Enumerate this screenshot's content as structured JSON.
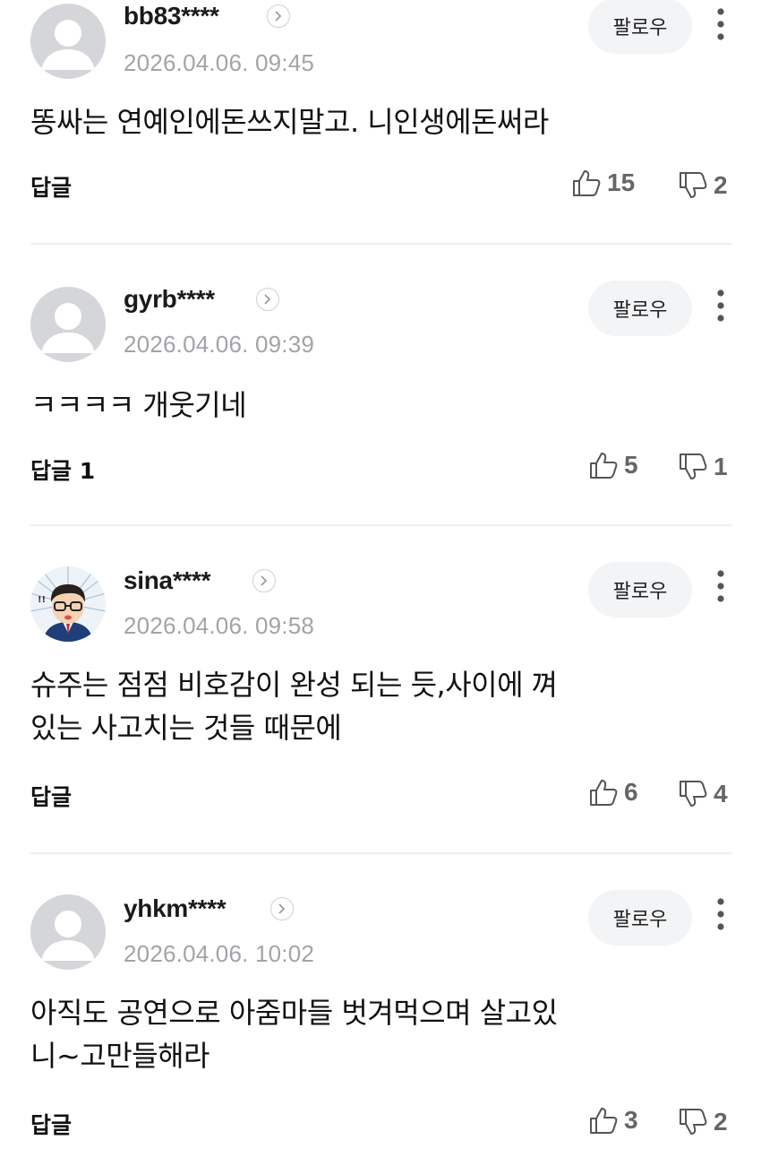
{
  "follow_label": "팔로우",
  "comments": [
    {
      "username": "bb83****",
      "date": "2026.04.06. 09:45",
      "text": "똥싸는 연예인에돈쓰지말고. 니인생에돈써라",
      "reply_label": "답글",
      "likes": "15",
      "dislikes": "2",
      "avatar": "default-avatar"
    },
    {
      "username": "gyrb****",
      "date": "2026.04.06. 09:39",
      "text": "ㅋㅋㅋㅋ 개웃기네",
      "reply_label": "답글 1",
      "likes": "5",
      "dislikes": "1",
      "avatar": "default-avatar"
    },
    {
      "username": "sina****",
      "date": "2026.04.06. 09:58",
      "text": "슈주는 점점 비호감이 완성 되는 듯,사이에 껴\n있는 사고치는 것들 때문에",
      "reply_label": "답글",
      "likes": "6",
      "dislikes": "4",
      "avatar": "cartoon-man-avatar"
    },
    {
      "username": "yhkm****",
      "date": "2026.04.06. 10:02",
      "text": "아직도 공연으로 아줌마들 벗겨먹으며 살고있\n니~고만들해라",
      "reply_label": "답글",
      "likes": "3",
      "dislikes": "2",
      "avatar": "default-avatar"
    }
  ],
  "colors": {
    "avatar_bg": "#d5d6da",
    "date": "#a2a4a8",
    "follow_bg": "#f3f4f6",
    "divider": "#eeeeef",
    "icon": "#555555"
  }
}
